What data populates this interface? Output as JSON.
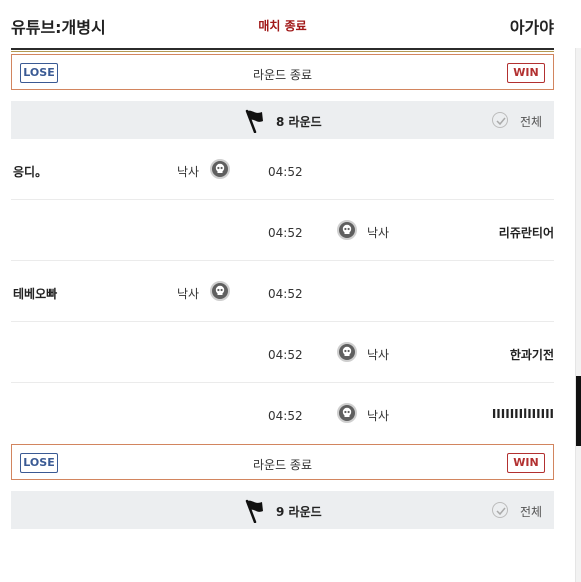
{
  "match": {
    "team_left": "유튜브:개병시",
    "status": "매치 종료",
    "team_right": "아가야"
  },
  "rounds": [
    {
      "result_top": {
        "lose": "LOSE",
        "text": "라운드 종료",
        "win": "WIN"
      },
      "label": "8 라운드",
      "filter_label": "전체",
      "events": [
        {
          "side": "left",
          "player": "응디。",
          "cause": "낙사",
          "time": "04:52"
        },
        {
          "side": "right",
          "player": "리쥬란티어",
          "cause": "낙사",
          "time": "04:52"
        },
        {
          "side": "left",
          "player": "테베오빠",
          "cause": "낙사",
          "time": "04:52"
        },
        {
          "side": "right",
          "player": "한과기전",
          "cause": "낙사",
          "time": "04:52"
        },
        {
          "side": "right",
          "player": "IIIIIIIlIIIIII",
          "cause": "낙사",
          "time": "04:52"
        }
      ],
      "result_bottom": {
        "lose": "LOSE",
        "text": "라운드 종료",
        "win": "WIN"
      }
    },
    {
      "label": "9 라운드",
      "filter_label": "전체"
    }
  ],
  "icons": {
    "flag": "flag-icon",
    "check": "check-circle-icon",
    "skull": "skull-icon"
  },
  "colors": {
    "lose": "#3a5a94",
    "win": "#b23030",
    "status": "#a01818",
    "result_border": "#d2855f"
  }
}
